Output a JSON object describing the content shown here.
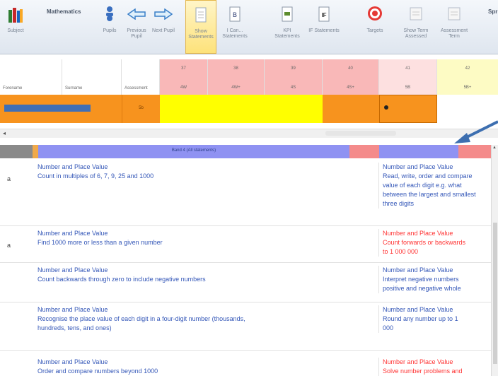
{
  "ribbon": {
    "title": "Mathematics",
    "title_right": "Spr",
    "subject_label": "Subject",
    "buttons": [
      {
        "label": "Pupils",
        "icon": "pupils-icon"
      },
      {
        "label": "Previous Pupil",
        "icon": "arrow-left-icon"
      },
      {
        "label": "Next Pupil",
        "icon": "arrow-right-icon"
      },
      {
        "label": "Show Statements",
        "icon": "document-icon"
      },
      {
        "label": "I Can... Statements",
        "icon": "clipboard-icon"
      },
      {
        "label": "KPI Statements",
        "icon": "kpi-icon"
      },
      {
        "label": "IF Statements",
        "icon": "if-icon"
      },
      {
        "label": "Targets",
        "icon": "target-icon"
      },
      {
        "label": "Show Term Assessed",
        "icon": "calendar-icon"
      },
      {
        "label": "Assessment Term",
        "icon": "calendar-term-icon"
      }
    ]
  },
  "header": {
    "col_forename": "Forename",
    "col_surname": "Surname",
    "col_assessment": "Assessment",
    "levels": [
      {
        "num": "37",
        "grade": "4W",
        "color": "#f9b8b8"
      },
      {
        "num": "38",
        "grade": "4W+",
        "color": "#f9b8b8"
      },
      {
        "num": "39",
        "grade": "4S",
        "color": "#f9b8b8"
      },
      {
        "num": "40",
        "grade": "4S+",
        "color": "#f9b8b8"
      },
      {
        "num": "41",
        "grade": "5B",
        "color": "#fde0e0"
      },
      {
        "num": "42",
        "grade": "5B+",
        "color": "#fdfbc4"
      }
    ]
  },
  "pupil": {
    "assessment": "5b"
  },
  "table": {
    "group_header": "Band 4 (All statements)",
    "rows": [
      {
        "mark": "a",
        "left": [
          "Number and Place Value",
          "Count in multiples of 6, 7, 9, 25 and 1000"
        ],
        "right": [
          "Number and Place Value",
          "Read, write, order and compare",
          "value of each digit e.g. what",
          "between the largest and smallest",
          "three digits"
        ],
        "right_red": false
      },
      {
        "mark": "a",
        "left": [
          "Number and Place Value",
          "Find 1000 more or less than a given number"
        ],
        "right": [
          "Number and Place Value",
          "Count forwards or backwards",
          "to 1 000 000"
        ],
        "right_red": true
      },
      {
        "mark": "",
        "left": [
          "Number and Place Value",
          "Count backwards through zero to include negative numbers"
        ],
        "right": [
          "Number and Place Value",
          "Interpret negative numbers",
          "positive and negative whole"
        ],
        "right_red": false
      },
      {
        "mark": "",
        "left": [
          "Number and Place Value",
          "Recognise the place value of each digit in a four-digit number (thousands,",
          "hundreds, tens, and ones)"
        ],
        "right": [
          "Number and Place Value",
          "Round any number up to 1",
          "000"
        ],
        "right_red": false
      },
      {
        "mark": "",
        "left": [
          "Number and Place Value",
          "Order and compare numbers beyond 1000"
        ],
        "right": [
          "Number and Place Value",
          "Solve number problems and"
        ],
        "right_red": true
      }
    ]
  }
}
